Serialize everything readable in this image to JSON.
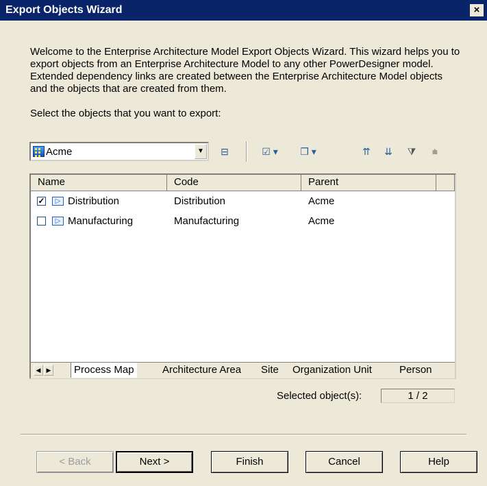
{
  "window": {
    "title": "Export Objects Wizard",
    "close_label": "×"
  },
  "intro": "Welcome to the Enterprise Architecture Model Export Objects Wizard. This wizard helps you to export objects from an Enterprise Architecture Model to any other PowerDesigner model. Extended dependency links are created between the Enterprise Architecture Model objects and the objects that are created from them.",
  "prompt": "Select the objects that you want to export:",
  "toolbar": {
    "model_selector": {
      "value": "Acme",
      "icon": "model-icon"
    },
    "buttons": [
      {
        "name": "include-submodels-icon",
        "glyph": "⊟"
      },
      {
        "name": "select-all-dropdown",
        "glyph": "☑ ▾"
      },
      {
        "name": "deselect-all-dropdown",
        "glyph": "❐ ▾"
      },
      {
        "name": "move-to-top-icon",
        "glyph": "⇈"
      },
      {
        "name": "move-to-bottom-icon",
        "glyph": "⇊"
      },
      {
        "name": "filter-icon",
        "glyph": "⧩"
      },
      {
        "name": "filter-columns-icon",
        "glyph": "⩧"
      }
    ]
  },
  "table": {
    "columns": [
      "Name",
      "Code",
      "Parent"
    ],
    "rows": [
      {
        "checked": true,
        "name": "Distribution",
        "code": "Distribution",
        "parent": "Acme"
      },
      {
        "checked": false,
        "name": "Manufacturing",
        "code": "Manufacturing",
        "parent": "Acme"
      }
    ]
  },
  "tabs": [
    "Process Map",
    "Architecture Area",
    "Site",
    "Organization Unit",
    "Person"
  ],
  "active_tab": "Process Map",
  "selection": {
    "label": "Selected object(s):",
    "value": "1 / 2"
  },
  "buttons": {
    "back": "< Back",
    "next": "Next >",
    "finish": "Finish",
    "cancel": "Cancel",
    "help": "Help"
  },
  "colors": {
    "titlebar": "#0a246a",
    "dialog_bg": "#ece9d8",
    "list_bg": "#ffffff"
  }
}
